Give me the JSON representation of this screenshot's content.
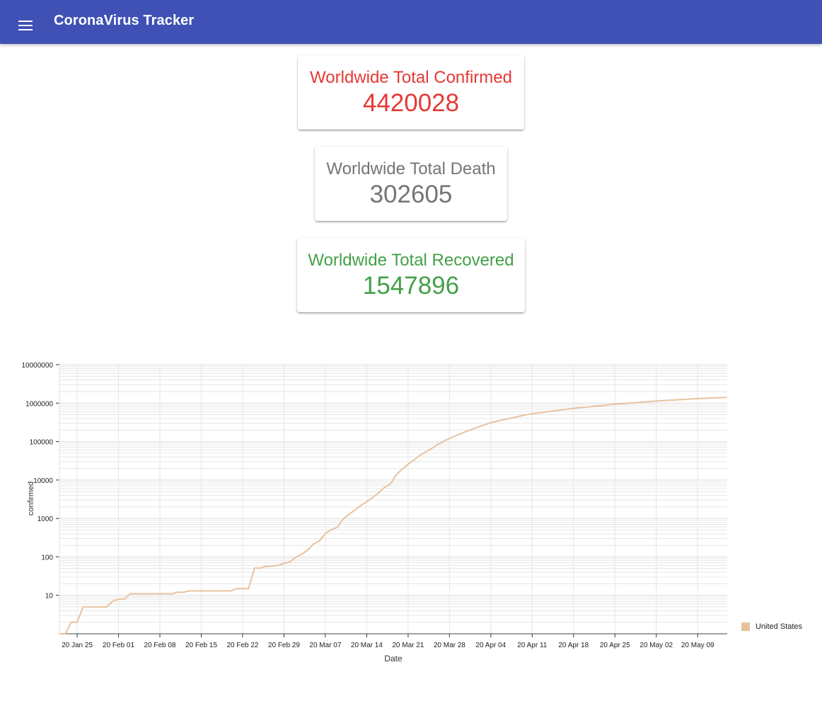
{
  "app": {
    "title": "CoronaVirus Tracker"
  },
  "cards": [
    {
      "label": "Worldwide Total Confirmed",
      "value": "4420028",
      "color": "#e53935"
    },
    {
      "label": "Worldwide Total Death",
      "value": "302605",
      "color": "#757575"
    },
    {
      "label": "Worldwide Total Recovered",
      "value": "1547896",
      "color": "#43a047"
    }
  ],
  "colors": {
    "appbar": "#3f51b5",
    "series": "#e8c29e",
    "grid": "#e6e6e6"
  },
  "chart_data": {
    "type": "line",
    "y_scale": "log",
    "xlabel": "Date",
    "ylabel": "confirmed",
    "grid": true,
    "legend_position": "right",
    "x_range": [
      "2020-01-22",
      "2020-05-14"
    ],
    "y_ticks": [
      10,
      100,
      1000,
      10000,
      100000,
      1000000,
      10000000
    ],
    "y_tick_labels": [
      "10",
      "100",
      "1000",
      "10000",
      "100000",
      "1000000",
      "10000000"
    ],
    "x_ticks": [
      "2020-01-25",
      "2020-02-01",
      "2020-02-08",
      "2020-02-15",
      "2020-02-22",
      "2020-02-29",
      "2020-03-07",
      "2020-03-14",
      "2020-03-21",
      "2020-03-28",
      "2020-04-04",
      "2020-04-11",
      "2020-04-18",
      "2020-04-25",
      "2020-05-02",
      "2020-05-09"
    ],
    "x_tick_labels": [
      "20 Jan 25",
      "20 Feb 01",
      "20 Feb 08",
      "20 Feb 15",
      "20 Feb 22",
      "20 Feb 29",
      "20 Mar 07",
      "20 Mar 14",
      "20 Mar 21",
      "20 Mar 28",
      "20 Apr 04",
      "20 Apr 11",
      "20 Apr 18",
      "20 Apr 25",
      "20 May 02",
      "20 May 09"
    ],
    "series": [
      {
        "name": "United States",
        "points": [
          [
            "2020-01-22",
            1
          ],
          [
            "2020-01-23",
            1
          ],
          [
            "2020-01-24",
            2
          ],
          [
            "2020-01-25",
            2
          ],
          [
            "2020-01-26",
            5
          ],
          [
            "2020-01-27",
            5
          ],
          [
            "2020-01-28",
            5
          ],
          [
            "2020-01-29",
            5
          ],
          [
            "2020-01-30",
            5
          ],
          [
            "2020-01-31",
            7
          ],
          [
            "2020-02-01",
            8
          ],
          [
            "2020-02-02",
            8
          ],
          [
            "2020-02-03",
            11
          ],
          [
            "2020-02-04",
            11
          ],
          [
            "2020-02-05",
            11
          ],
          [
            "2020-02-06",
            11
          ],
          [
            "2020-02-07",
            11
          ],
          [
            "2020-02-08",
            11
          ],
          [
            "2020-02-09",
            11
          ],
          [
            "2020-02-10",
            11
          ],
          [
            "2020-02-11",
            12
          ],
          [
            "2020-02-12",
            12
          ],
          [
            "2020-02-13",
            13
          ],
          [
            "2020-02-14",
            13
          ],
          [
            "2020-02-15",
            13
          ],
          [
            "2020-02-16",
            13
          ],
          [
            "2020-02-17",
            13
          ],
          [
            "2020-02-18",
            13
          ],
          [
            "2020-02-19",
            13
          ],
          [
            "2020-02-20",
            13
          ],
          [
            "2020-02-21",
            15
          ],
          [
            "2020-02-22",
            15
          ],
          [
            "2020-02-23",
            15
          ],
          [
            "2020-02-24",
            51
          ],
          [
            "2020-02-25",
            51
          ],
          [
            "2020-02-26",
            57
          ],
          [
            "2020-02-27",
            58
          ],
          [
            "2020-02-28",
            60
          ],
          [
            "2020-02-29",
            68
          ],
          [
            "2020-03-01",
            74
          ],
          [
            "2020-03-02",
            98
          ],
          [
            "2020-03-03",
            118
          ],
          [
            "2020-03-04",
            149
          ],
          [
            "2020-03-05",
            217
          ],
          [
            "2020-03-06",
            262
          ],
          [
            "2020-03-07",
            402
          ],
          [
            "2020-03-08",
            518
          ],
          [
            "2020-03-09",
            583
          ],
          [
            "2020-03-10",
            959
          ],
          [
            "2020-03-11",
            1281
          ],
          [
            "2020-03-12",
            1663
          ],
          [
            "2020-03-13",
            2179
          ],
          [
            "2020-03-14",
            2727
          ],
          [
            "2020-03-15",
            3499
          ],
          [
            "2020-03-16",
            4632
          ],
          [
            "2020-03-17",
            6421
          ],
          [
            "2020-03-18",
            7783
          ],
          [
            "2020-03-19",
            13747
          ],
          [
            "2020-03-20",
            19273
          ],
          [
            "2020-03-21",
            25600
          ],
          [
            "2020-03-22",
            33276
          ],
          [
            "2020-03-23",
            43847
          ],
          [
            "2020-03-24",
            53740
          ],
          [
            "2020-03-25",
            65778
          ],
          [
            "2020-03-26",
            83836
          ],
          [
            "2020-03-27",
            101657
          ],
          [
            "2020-03-28",
            121465
          ],
          [
            "2020-03-29",
            140909
          ],
          [
            "2020-03-30",
            161831
          ],
          [
            "2020-03-31",
            188172
          ],
          [
            "2020-04-01",
            213242
          ],
          [
            "2020-04-02",
            243622
          ],
          [
            "2020-04-03",
            275367
          ],
          [
            "2020-04-04",
            308650
          ],
          [
            "2020-04-05",
            336802
          ],
          [
            "2020-04-06",
            366317
          ],
          [
            "2020-04-07",
            397121
          ],
          [
            "2020-04-08",
            428654
          ],
          [
            "2020-04-09",
            462780
          ],
          [
            "2020-04-10",
            496535
          ],
          [
            "2020-04-11",
            526396
          ],
          [
            "2020-04-12",
            555313
          ],
          [
            "2020-04-13",
            580619
          ],
          [
            "2020-04-14",
            607670
          ],
          [
            "2020-04-15",
            636350
          ],
          [
            "2020-04-16",
            667592
          ],
          [
            "2020-04-17",
            699706
          ],
          [
            "2020-04-18",
            732197
          ],
          [
            "2020-04-19",
            758809
          ],
          [
            "2020-04-20",
            784326
          ],
          [
            "2020-04-21",
            811865
          ],
          [
            "2020-04-22",
            840351
          ],
          [
            "2020-04-23",
            869170
          ],
          [
            "2020-04-24",
            905358
          ],
          [
            "2020-04-25",
            938154
          ],
          [
            "2020-04-26",
            965785
          ],
          [
            "2020-04-27",
            988197
          ],
          [
            "2020-04-28",
            1012582
          ],
          [
            "2020-04-29",
            1039909
          ],
          [
            "2020-04-30",
            1069424
          ],
          [
            "2020-05-01",
            1103461
          ],
          [
            "2020-05-02",
            1132539
          ],
          [
            "2020-05-03",
            1158040
          ],
          [
            "2020-05-04",
            1180375
          ],
          [
            "2020-05-05",
            1204351
          ],
          [
            "2020-05-06",
            1229331
          ],
          [
            "2020-05-07",
            1257023
          ],
          [
            "2020-05-08",
            1283929
          ],
          [
            "2020-05-09",
            1309550
          ],
          [
            "2020-05-10",
            1329260
          ],
          [
            "2020-05-11",
            1347881
          ],
          [
            "2020-05-12",
            1369376
          ],
          [
            "2020-05-13",
            1390406
          ],
          [
            "2020-05-14",
            1417774
          ]
        ]
      }
    ]
  }
}
